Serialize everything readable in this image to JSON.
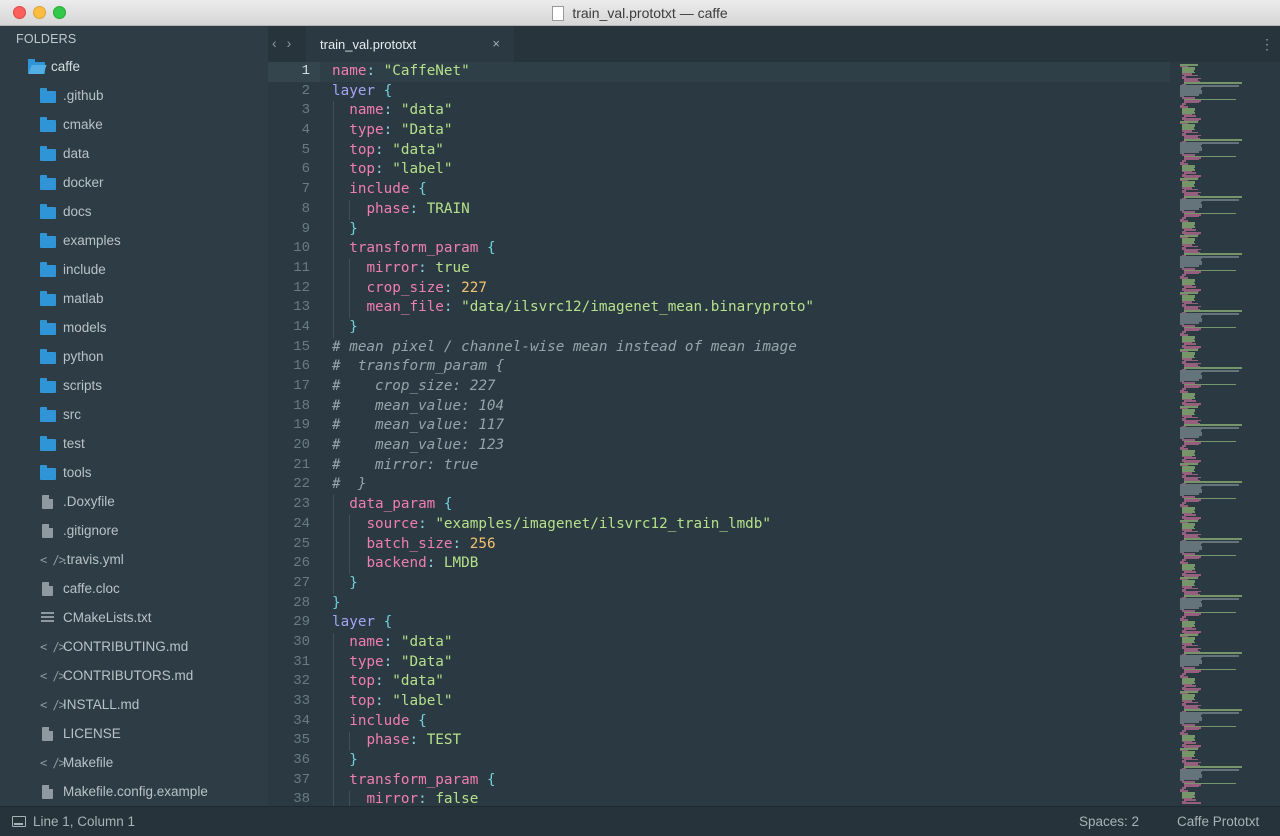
{
  "window": {
    "title": "train_val.prototxt — caffe"
  },
  "sidebar": {
    "header": "FOLDERS",
    "root": "caffe",
    "folders": [
      ".github",
      "cmake",
      "data",
      "docker",
      "docs",
      "examples",
      "include",
      "matlab",
      "models",
      "python",
      "scripts",
      "src",
      "test",
      "tools"
    ],
    "files": [
      {
        "name": ".Doxyfile",
        "icon": "file-icon"
      },
      {
        "name": ".gitignore",
        "icon": "file-icon"
      },
      {
        "name": ".travis.yml",
        "icon": "code-icon"
      },
      {
        "name": "caffe.cloc",
        "icon": "file-icon"
      },
      {
        "name": "CMakeLists.txt",
        "icon": "lines-icon"
      },
      {
        "name": "CONTRIBUTING.md",
        "icon": "code-icon"
      },
      {
        "name": "CONTRIBUTORS.md",
        "icon": "code-icon"
      },
      {
        "name": "INSTALL.md",
        "icon": "code-icon"
      },
      {
        "name": "LICENSE",
        "icon": "file-icon"
      },
      {
        "name": "Makefile",
        "icon": "code-icon"
      },
      {
        "name": "Makefile.config.example",
        "icon": "file-icon"
      }
    ]
  },
  "tabs": {
    "back": "‹",
    "forward": "›",
    "active_label": "train_val.prototxt",
    "close": "×",
    "menu": "⋮"
  },
  "editor": {
    "active_line": 1,
    "lines": [
      "name: \"CaffeNet\"",
      "layer {",
      "  name: \"data\"",
      "  type: \"Data\"",
      "  top: \"data\"",
      "  top: \"label\"",
      "  include {",
      "    phase: TRAIN",
      "  }",
      "  transform_param {",
      "    mirror: true",
      "    crop_size: 227",
      "    mean_file: \"data/ilsvrc12/imagenet_mean.binaryproto\"",
      "  }",
      "# mean pixel / channel-wise mean instead of mean image",
      "#  transform_param {",
      "#    crop_size: 227",
      "#    mean_value: 104",
      "#    mean_value: 117",
      "#    mean_value: 123",
      "#    mirror: true",
      "#  }",
      "  data_param {",
      "    source: \"examples/imagenet/ilsvrc12_train_lmdb\"",
      "    batch_size: 256",
      "    backend: LMDB",
      "  }",
      "}",
      "layer {",
      "  name: \"data\"",
      "  type: \"Data\"",
      "  top: \"data\"",
      "  top: \"label\"",
      "  include {",
      "    phase: TEST",
      "  }",
      "  transform_param {",
      "    mirror: false"
    ]
  },
  "colors": {
    "key": "#f07db0",
    "layer_keyword": "#a5a3f5",
    "string": "#b5e08a",
    "number": "#f5c26b",
    "brace": "#6fd0d9",
    "comment": "#96a4ab",
    "background": "#2b3a42"
  },
  "status": {
    "position": "Line 1, Column 1",
    "spaces": "Spaces: 2",
    "syntax": "Caffe Prototxt"
  }
}
